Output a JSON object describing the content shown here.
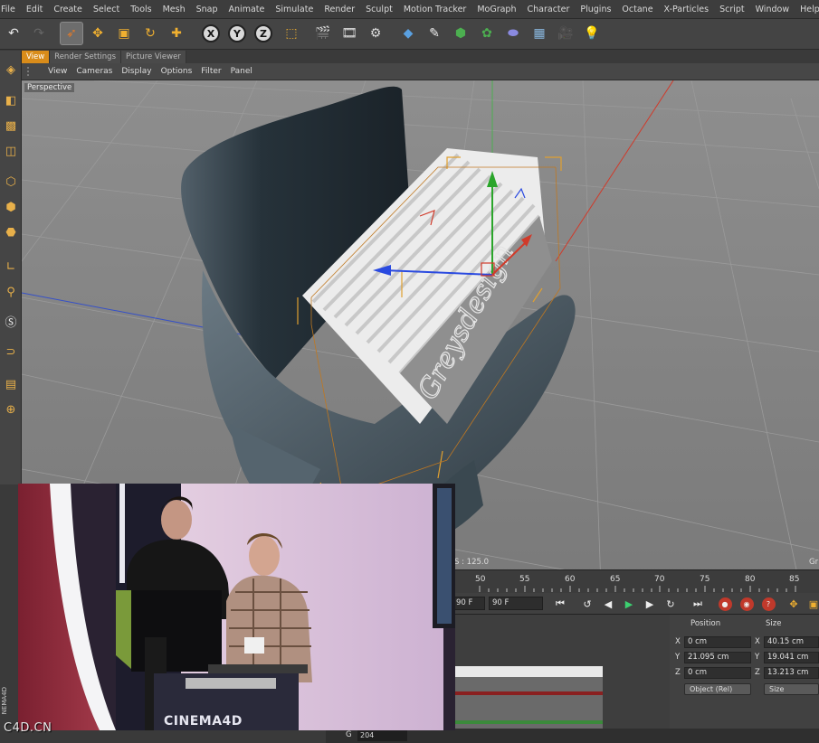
{
  "menubar": {
    "items": [
      "File",
      "Edit",
      "Create",
      "Select",
      "Tools",
      "Mesh",
      "Snap",
      "Animate",
      "Simulate",
      "Render",
      "Sculpt",
      "Motion Tracker",
      "MoGraph",
      "Character",
      "Plugins",
      "Octane",
      "X-Particles",
      "Script",
      "Window",
      "Help"
    ]
  },
  "toolbar": {
    "axis_x": "X",
    "axis_y": "Y",
    "axis_z": "Z"
  },
  "tabs": [
    "View",
    "Render Settings",
    "Picture Viewer"
  ],
  "viewport_menu": [
    "View",
    "Cameras",
    "Display",
    "Options",
    "Filter",
    "Panel"
  ],
  "viewport": {
    "label": "Perspective"
  },
  "timeline": {
    "ruler_label": "S : 125.0",
    "ruler_extra": "Gr",
    "ticks": [
      "50",
      "55",
      "60",
      "65",
      "70",
      "75",
      "80",
      "85"
    ],
    "start_field": "90 F",
    "end_field": "90 F"
  },
  "coordinates": {
    "position_header": "Position",
    "size_header": "Size",
    "rows": [
      {
        "axis": "X",
        "pos": "0 cm",
        "size_axis": "X",
        "size": "40.15 cm"
      },
      {
        "axis": "Y",
        "pos": "21.095 cm",
        "size_axis": "Y",
        "size": "19.041 cm"
      },
      {
        "axis": "Z",
        "pos": "0 cm",
        "size_axis": "Z",
        "size": "13.213 cm"
      }
    ],
    "mode_select": "Object (Rel)",
    "size_select": "Size"
  },
  "status": {
    "g_label": "G",
    "g_value": "204"
  },
  "webcam": {
    "banner": "CINEMA4D",
    "side_text": "NEMA4D"
  },
  "watermark": "C4D.CN",
  "colors": {
    "accent_orange": "#d98c1a",
    "axis_x": "#e0342a",
    "axis_y": "#2aa52a",
    "axis_z": "#2a4ae0",
    "grid_bg": "#8a8a8a"
  }
}
